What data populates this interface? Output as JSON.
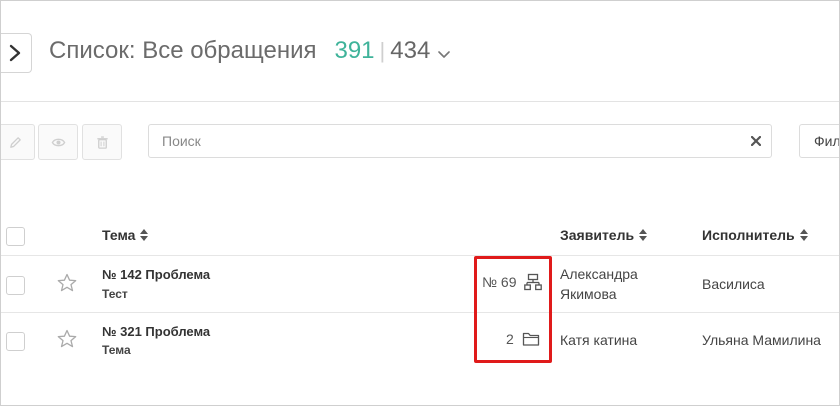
{
  "header": {
    "title": "Список: Все обращения",
    "count_filtered": "391",
    "count_separator": "|",
    "count_total": "434"
  },
  "toolbar": {
    "search_placeholder": "Поиск",
    "filter_label": "Фил"
  },
  "table": {
    "columns": [
      {
        "label": "Тема"
      },
      {
        "label": "Заявитель"
      },
      {
        "label": "Исполнитель"
      }
    ],
    "rows": [
      {
        "title": "№ 142 Проблема",
        "subtitle": "Тест",
        "meta": "№ 69",
        "meta_icon": "hierarchy-icon",
        "requester_line1": "Александра",
        "requester_line2": "Якимова",
        "assignee": "Василиса"
      },
      {
        "title": "№ 321 Проблема",
        "subtitle": "Тема",
        "meta": "2",
        "meta_icon": "folder-icon",
        "requester_line1": "Катя катина",
        "requester_line2": "",
        "assignee": "Ульяна Мамилина"
      }
    ]
  },
  "colors": {
    "accent": "#3fb39a",
    "highlight": "#e01a1a"
  }
}
